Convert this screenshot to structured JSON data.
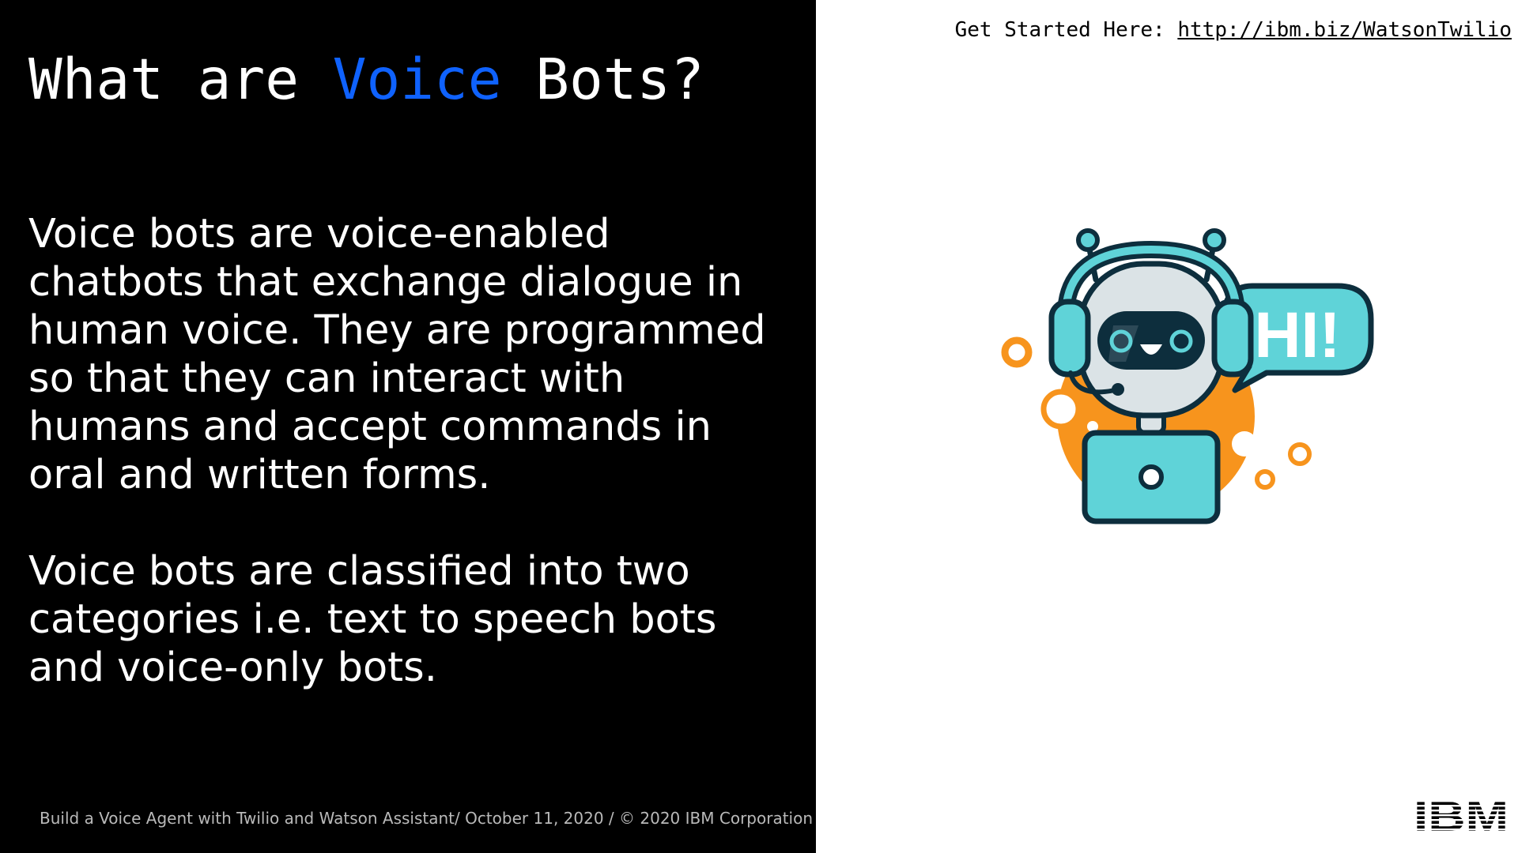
{
  "slide": {
    "title_before": "What are ",
    "title_accent": "Voice",
    "title_after": " Bots?",
    "paragraph_1": "Voice bots are voice-enabled chatbots that exchange dialogue in human voice. They are programmed so that they can interact with humans and accept commands in oral and written forms.",
    "paragraph_2": "Voice bots are classified into two categories i.e. text to speech bots and voice-only bots.",
    "footer": "Build a Voice Agent with Twilio and Watson Assistant/ October 11, 2020 / © 2020 IBM Corporation"
  },
  "header": {
    "get_started_label": "Get Started Here: ",
    "link_text": "http://ibm.biz/WatsonTwilio"
  },
  "illustration": {
    "speech_bubble_text": "HI!"
  },
  "logo": {
    "text": "IBM"
  },
  "colors": {
    "accent": "#0f62fe",
    "robot_teal": "#5fd3d8",
    "robot_orange": "#f7941d",
    "robot_outline": "#0d2e3d",
    "robot_face": "#dbe3e6"
  }
}
